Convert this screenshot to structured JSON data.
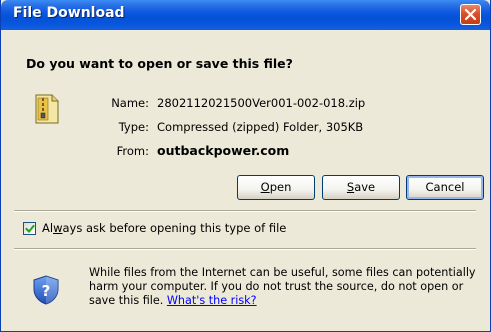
{
  "window": {
    "title": "File Download"
  },
  "dialog": {
    "question": "Do you want to open or save this file?",
    "name_label": "Name:",
    "name_value": "2802112021500Ver001-002-018.zip",
    "type_label": "Type:",
    "type_value": "Compressed (zipped) Folder, 305KB",
    "from_label": "From:",
    "from_value": "outbackpower.com"
  },
  "buttons": {
    "open": {
      "label": "Open",
      "accel": "O",
      "rest": "pen"
    },
    "save": {
      "label": "Save",
      "accel": "S",
      "rest": "ave"
    },
    "cancel": {
      "label": "Cancel"
    }
  },
  "checkbox": {
    "checked": true,
    "label": "Always ask before opening this type of file",
    "label_pre": "Al",
    "label_accel": "w",
    "label_post": "ays ask before opening this type of file"
  },
  "warning": {
    "line1": "While files from the Internet can be useful, some files can potentially",
    "line2": "harm your computer. If you do not trust the source, do not open or",
    "line3_text": "save this file. ",
    "link": "What's the risk?"
  },
  "colors": {
    "title_bar": "#0451d8",
    "dialog_bg": "#ece9d8",
    "link": "#0000ff",
    "close_button": "#d9502c"
  },
  "icons": {
    "close": "close-icon",
    "file": "zip-file-icon",
    "shield": "security-shield-icon",
    "checkmark": "checkmark-icon"
  }
}
